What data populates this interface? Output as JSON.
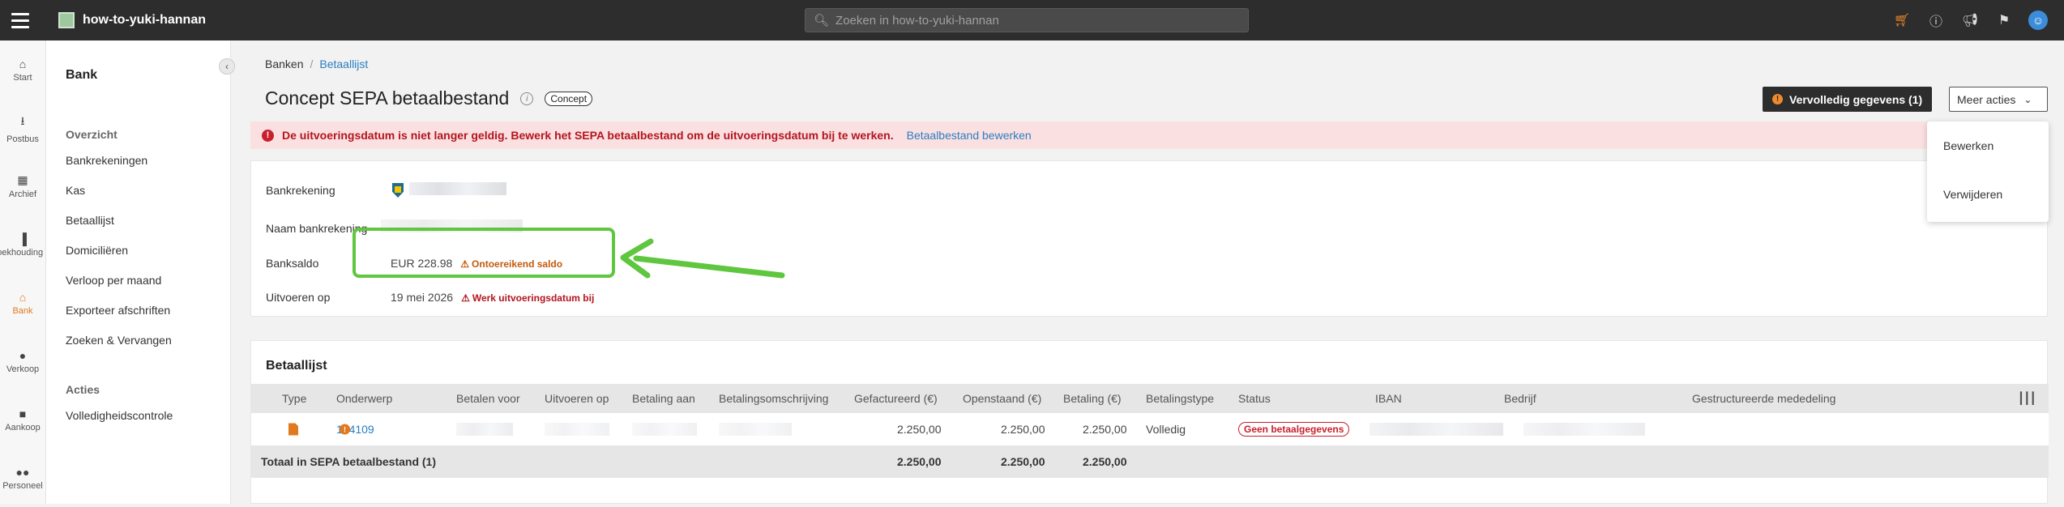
{
  "topbar": {
    "app_title": "how-to-yuki-hannan",
    "search_placeholder": "Zoeken in how-to-yuki-hannan",
    "icons": [
      "cart-icon",
      "info-icon",
      "megaphone-icon",
      "bookmark-icon",
      "user-icon"
    ]
  },
  "rail": {
    "items": [
      {
        "label": "Start",
        "icon": "home-icon"
      },
      {
        "label": "Postbus",
        "icon": "inbox-icon"
      },
      {
        "label": "Archief",
        "icon": "archive-icon"
      },
      {
        "label": "Boekhouding",
        "icon": "chart-icon"
      },
      {
        "label": "Bank",
        "icon": "bank-icon",
        "active": true
      },
      {
        "label": "Verkoop",
        "icon": "chat-icon"
      },
      {
        "label": "Aankoop",
        "icon": "truck-icon"
      },
      {
        "label": "Personeel",
        "icon": "people-icon"
      }
    ]
  },
  "sidebar": {
    "title": "Bank",
    "section1": "Overzicht",
    "items1": [
      "Bankrekeningen",
      "Kas",
      "Betaallijst",
      "Domiciliëren",
      "Verloop per maand",
      "Exporteer afschriften",
      "Zoeken & Vervangen"
    ],
    "section2": "Acties",
    "items2": [
      "Volledigheidscontrole"
    ]
  },
  "breadcrumb": {
    "root": "Banken",
    "current": "Betaallijst"
  },
  "page": {
    "title": "Concept SEPA betaalbestand",
    "badge": "Concept",
    "primary_button": "Vervolledig gegevens (1)",
    "more_button": "Meer acties"
  },
  "alert": {
    "message": "De uitvoeringsdatum is niet langer geldig. Bewerk het SEPA betaalbestand om de uitvoeringsdatum bij te werken.",
    "action": "Betaalbestand bewerken"
  },
  "dropdown": {
    "items": [
      "Bewerken",
      "Verwijderen"
    ]
  },
  "details": {
    "bankrekening_label": "Bankrekening",
    "naam_label": "Naam bankrekening",
    "banksaldo_label": "Banksaldo",
    "banksaldo_value": "EUR 228.98",
    "banksaldo_warning": "Ontoereikend saldo",
    "uitvoeren_label": "Uitvoeren op",
    "uitvoeren_value": "19 mei 2026",
    "uitvoeren_warning": "Werk uitvoeringsdatum bij"
  },
  "table": {
    "title": "Betaallijst",
    "columns": [
      "Type",
      "Onderwerp",
      "Betalen voor",
      "Uitvoeren op",
      "Betaling aan",
      "Betalingsomschrijving",
      "Gefactureerd (€)",
      "Openstaand (€)",
      "Betaling (€)",
      "Betalingstype",
      "Status",
      "IBAN",
      "Bedrijf",
      "Gestructureerde mededeling"
    ],
    "rows": [
      {
        "onderwerp": "104109",
        "gefactureerd": "2.250,00",
        "openstaand": "2.250,00",
        "betaling": "2.250,00",
        "betalingstype": "Volledig",
        "status": "Geen betaalgegevens"
      }
    ],
    "total": {
      "label": "Totaal in SEPA betaalbestand (1)",
      "gefactureerd": "2.250,00",
      "openstaand": "2.250,00",
      "betaling": "2.250,00"
    }
  },
  "colors": {
    "accent": "#e07a1f",
    "link": "#2a7ec2",
    "danger": "#c8202d",
    "highlight": "#5fc63f"
  }
}
